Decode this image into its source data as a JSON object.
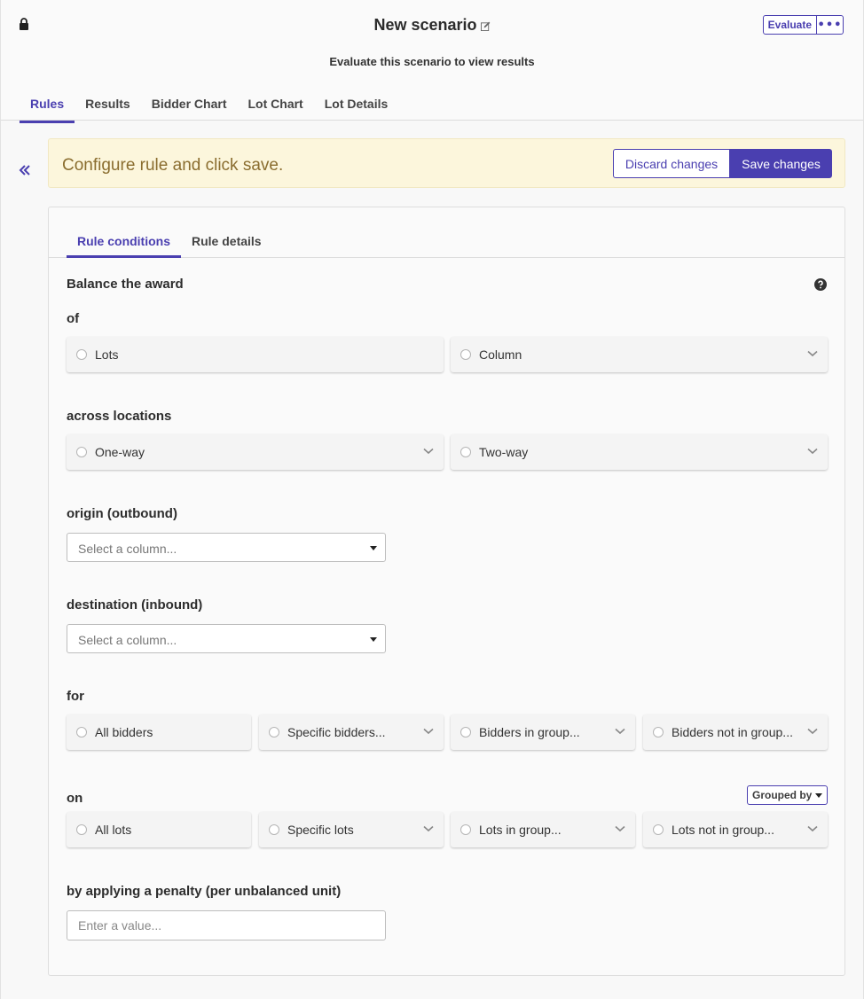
{
  "header": {
    "title": "New scenario",
    "subtitle": "Evaluate this scenario to view results",
    "evaluate_label": "Evaluate",
    "more_label": "•••",
    "tabs": [
      {
        "label": "Rules",
        "active": true
      },
      {
        "label": "Results"
      },
      {
        "label": "Bidder Chart"
      },
      {
        "label": "Lot Chart"
      },
      {
        "label": "Lot Details"
      }
    ]
  },
  "banner": {
    "message": "Configure rule and click save.",
    "discard_label": "Discard changes",
    "save_label": "Save changes"
  },
  "panel": {
    "tabs": [
      {
        "label": "Rule conditions",
        "active": true
      },
      {
        "label": "Rule details"
      }
    ],
    "rule_title": "Balance the award",
    "of": {
      "label": "of",
      "options": [
        {
          "label": "Lots",
          "dropdown": false
        },
        {
          "label": "Column",
          "dropdown": true
        }
      ]
    },
    "across": {
      "label": "across locations",
      "options": [
        {
          "label": "One-way",
          "dropdown": true
        },
        {
          "label": "Two-way",
          "dropdown": true
        }
      ]
    },
    "origin": {
      "label": "origin (outbound)",
      "placeholder": "Select a column..."
    },
    "destination": {
      "label": "destination (inbound)",
      "placeholder": "Select a column..."
    },
    "for": {
      "label": "for",
      "options": [
        {
          "label": "All bidders",
          "dropdown": false
        },
        {
          "label": "Specific bidders...",
          "dropdown": true
        },
        {
          "label": "Bidders in group...",
          "dropdown": true
        },
        {
          "label": "Bidders not in group...",
          "dropdown": true
        }
      ]
    },
    "on": {
      "label": "on",
      "grouped_by_label": "Grouped by",
      "options": [
        {
          "label": "All lots",
          "dropdown": false
        },
        {
          "label": "Specific lots",
          "dropdown": true
        },
        {
          "label": "Lots in group...",
          "dropdown": true
        },
        {
          "label": "Lots not in group...",
          "dropdown": true
        }
      ]
    },
    "penalty": {
      "label": "by applying a penalty (per unbalanced unit)",
      "placeholder": "Enter a value..."
    }
  },
  "colors": {
    "accent": "#4a3fb0",
    "banner_bg": "#fcf6dc",
    "banner_text": "#8a6d2f"
  }
}
